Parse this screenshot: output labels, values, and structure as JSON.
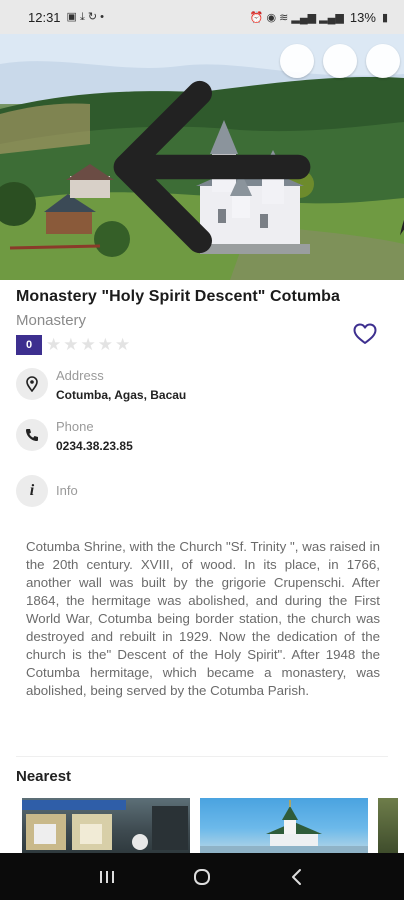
{
  "status_bar": {
    "time": "12:31",
    "battery": "13%"
  },
  "place": {
    "title": "Monastery \"Holy Spirit Descent\" Cotumba",
    "category": "Monastery",
    "rating": "0",
    "stars_filled": 0,
    "stars_total": 5
  },
  "address": {
    "label": "Address",
    "value": "Cotumba, Agas, Bacau"
  },
  "phone": {
    "label": "Phone",
    "value": "0234.38.23.85"
  },
  "info": {
    "label": "Info"
  },
  "description": "Cotumba Shrine, with the Church \"Sf. Trinity \", was raised in the 20th century. XVIII, of wood. In its place, in 1766, another wall was built by the grigorie Crupenschi. After 1864, the hermitage was abolished, and during the First World War, Cotumba being border station, the church was destroyed and rebuilt in 1929. Now the dedication of the church is the\" Descent of the Holy Spirit\". After 1948 the Cotumba hermitage, which became a monastery, was abolished, being served by the Cotumba Parish.",
  "nearest": {
    "heading": "Nearest"
  },
  "icons": {
    "back": "arrow-left-icon",
    "share": "share-icon",
    "map": "map-icon",
    "gallery": "image-icon",
    "favorite": "heart-icon",
    "address": "location-pin-icon",
    "phone": "phone-icon",
    "info": "info-icon"
  },
  "colors": {
    "accent": "#3d2f8f"
  }
}
